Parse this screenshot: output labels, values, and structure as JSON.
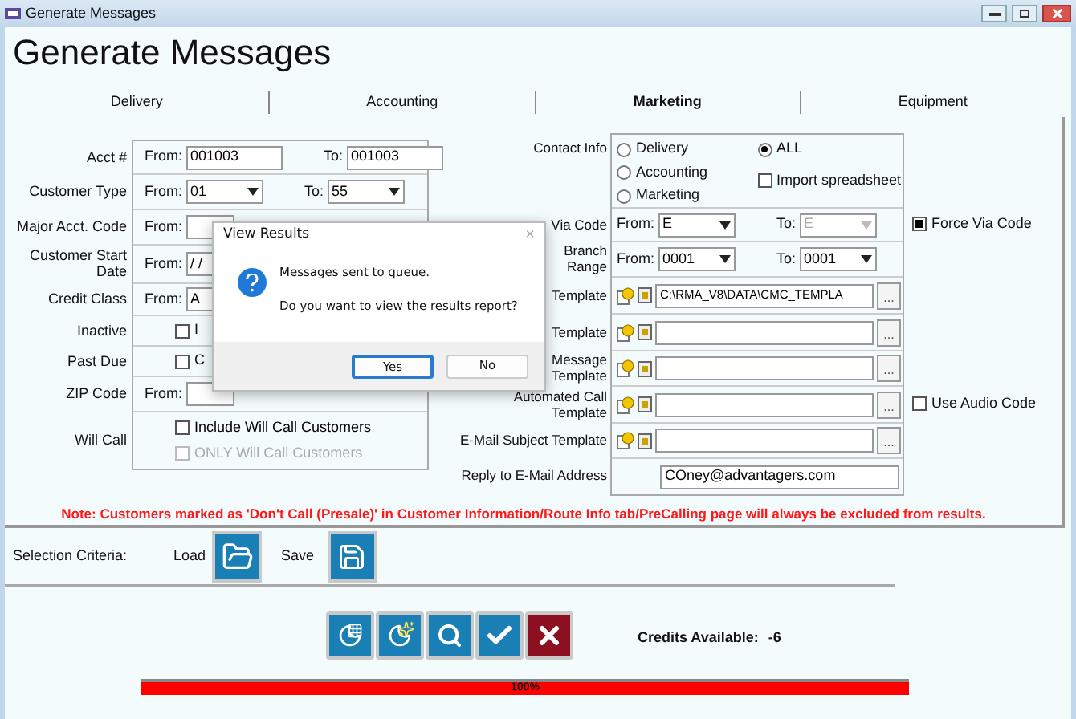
{
  "window": {
    "title": "Generate Messages"
  },
  "heading": "Generate Messages",
  "tabs": [
    {
      "label": "Delivery",
      "selected": false
    },
    {
      "label": "Accounting",
      "selected": false
    },
    {
      "label": "Marketing",
      "selected": true
    },
    {
      "label": "Equipment",
      "selected": false
    }
  ],
  "left_rows": [
    {
      "label": "Acct #",
      "kind": "text_range",
      "from_label": "From:",
      "from": "001003",
      "to_label": "To:",
      "to": "001003"
    },
    {
      "label": "Customer Type",
      "kind": "select_range",
      "from_label": "From:",
      "from": "01",
      "to_label": "To:",
      "to": "55"
    },
    {
      "label": "Major Acct. Code",
      "kind": "covered",
      "from_label": "From:"
    },
    {
      "label": "Customer Start\nDate",
      "kind": "covered",
      "from_label": "From:",
      "from": "/ /"
    },
    {
      "label": "Credit Class",
      "kind": "covered",
      "from_label": "From:",
      "from": "A"
    },
    {
      "label": "Inactive",
      "kind": "checkbox",
      "checked": false,
      "text": "I"
    },
    {
      "label": "Past Due",
      "kind": "checkbox",
      "checked": false,
      "text": "C"
    },
    {
      "label": "ZIP Code",
      "kind": "covered",
      "from_label": "From:"
    },
    {
      "label": "Will Call",
      "kind": "checks",
      "items": [
        {
          "label": "Include Will Call Customers",
          "checked": false,
          "disabled": false
        },
        {
          "label": "ONLY Will Call Customers",
          "checked": false,
          "disabled": true
        }
      ]
    }
  ],
  "right_rows": [
    {
      "label": "Contact Info",
      "kind": "radios",
      "options": [
        {
          "label": "Delivery",
          "selected": false
        },
        {
          "label": "Accounting",
          "selected": false
        },
        {
          "label": "Marketing",
          "selected": false
        },
        {
          "label": "ALL",
          "selected": true
        }
      ],
      "extra": {
        "label": "Import spreadsheet",
        "checked": false
      }
    },
    {
      "label": "Via Code",
      "kind": "select_range",
      "from_label": "From:",
      "from": "E",
      "to_label": "To:",
      "to": "E",
      "to_disabled": true,
      "side": {
        "label": "Force Via Code",
        "checked": true
      }
    },
    {
      "label": "Branch\nRange",
      "kind": "select_range",
      "from_label": "From:",
      "from": "0001",
      "to_label": "To:",
      "to": "0001"
    },
    {
      "label": "Template",
      "kind": "template",
      "value": "C:\\RMA_V8\\DATA\\CMC_TEMPLA",
      "button": "..."
    },
    {
      "label": "Template",
      "kind": "template",
      "button": "..."
    },
    {
      "label": "Message\nTemplate",
      "kind": "template",
      "button": "..."
    },
    {
      "label": "Automated Call\nTemplate",
      "kind": "template",
      "button": "...",
      "side": {
        "label": "Use Audio Code",
        "checked": false
      }
    },
    {
      "label": "E-Mail Subject Template",
      "kind": "template",
      "button": "..."
    },
    {
      "label": "Reply to E-Mail Address",
      "kind": "text",
      "value": "COney@advantagers.com"
    }
  ],
  "note": "Note: Customers marked as 'Don't Call (Presale)' in Customer Information/Route Info tab/PreCalling page will always be excluded from results.",
  "selection": {
    "label": "Selection Criteria:",
    "load": "Load",
    "save": "Save"
  },
  "actions": [
    {
      "kind": "moon_grid"
    },
    {
      "kind": "moon_stars"
    },
    {
      "kind": "search"
    },
    {
      "kind": "check"
    },
    {
      "kind": "cancel"
    }
  ],
  "credits": {
    "label": "Credits Available:",
    "value": "-6"
  },
  "progress": {
    "level": 1,
    "text": "100%"
  },
  "dialog": {
    "title": "View Results",
    "close": "×",
    "lines": [
      "Messages sent to queue.",
      "Do you want to view the results report?"
    ],
    "buttons": [
      {
        "label": "Yes",
        "selected": true
      },
      {
        "label": "No",
        "selected": false
      }
    ]
  }
}
